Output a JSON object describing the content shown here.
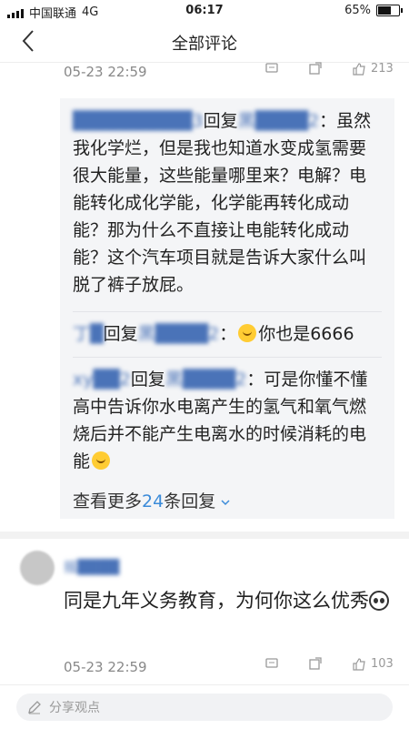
{
  "status": {
    "carrier": "中国联通",
    "network": "4G",
    "time": "06:17",
    "battery": "65%",
    "battery_level": 0.65
  },
  "nav": {
    "title": "全部评论"
  },
  "comment1": {
    "date": "05-23 22:59",
    "likes": "213"
  },
  "replies": [
    {
      "name": "█████████3",
      "mid": "回复",
      "to": "黑████2",
      "text": "：虽然我化学烂，但是我也知道水变成氢需要很大能量，这些能量哪里来？电解？电能转化成化学能，化学能再转化成动能？那为什么不直接让电能转化成动能？这个汽车项目就是告诉大家什么叫脱了裤子放屁。"
    },
    {
      "name": "丁█",
      "mid": "回复",
      "to": "黑████2",
      "text_before": "：",
      "text_after": "你也是6666"
    },
    {
      "name": "xy██2",
      "mid": "回复",
      "to": "黑████2",
      "text": "：可是你懂不懂高中告诉你水电离产生的氢气和氧气燃烧后并不能产生电离水的时候消耗的电能"
    }
  ],
  "more": {
    "prefix": "查看更多",
    "count": "24",
    "suffix": "条回复"
  },
  "comment2": {
    "name": "摇████",
    "text": "同是九年义务教育，为何你这么优秀",
    "date": "05-23 22:59",
    "likes": "103"
  },
  "bottom": {
    "placeholder": "分享观点"
  }
}
